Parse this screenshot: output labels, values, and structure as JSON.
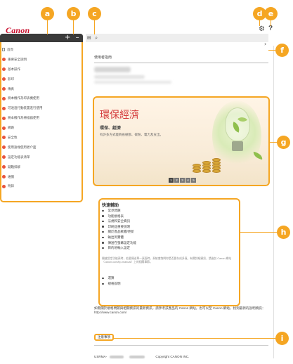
{
  "header": {
    "logo": "Canon",
    "settings_icon": "gear-icon",
    "help_icon": "question-icon"
  },
  "callouts": [
    "a",
    "b",
    "c",
    "d",
    "e",
    "f",
    "g",
    "h",
    "i"
  ],
  "sidebar": {
    "expand_label": "+",
    "collapse_label": "–",
    "items": [
      {
        "label": "首頁",
        "icon": "document-icon"
      },
      {
        "label": "重要安全說明",
        "icon": "dot-icon"
      },
      {
        "label": "基本操作",
        "icon": "dot-icon"
      },
      {
        "label": "影印",
        "icon": "dot-icon"
      },
      {
        "label": "傳真",
        "icon": "dot-icon"
      },
      {
        "label": "將本機作為印表機使用",
        "icon": "dot-icon"
      },
      {
        "label": "可透過行動裝置進行使用",
        "icon": "dot-icon"
      },
      {
        "label": "將本機作為掃描器使用",
        "icon": "dot-icon"
      },
      {
        "label": "網路",
        "icon": "dot-icon"
      },
      {
        "label": "安全性",
        "icon": "dot-icon"
      },
      {
        "label": "使用遠端使用者介面",
        "icon": "dot-icon"
      },
      {
        "label": "設定功能表清單",
        "icon": "dot-icon"
      },
      {
        "label": "疑難排解",
        "icon": "dot-icon"
      },
      {
        "label": "維護",
        "icon": "dot-icon"
      },
      {
        "label": "附錄",
        "icon": "dot-icon"
      }
    ]
  },
  "main": {
    "toolbar_icons": [
      "zoom-in-icon",
      "search-icon"
    ],
    "doc_title": "使用者指南",
    "banner": {
      "title": "環保經濟",
      "subtitle": "環保、經濟",
      "description": "有許多方式能夠省紙張、碳粉、電力及支出。",
      "pages": [
        "1",
        "2",
        "3",
        "4",
        "5"
      ],
      "active_page": 0
    },
    "quick_help": {
      "title": "快速輔助",
      "items": [
        "常見問題",
        "功能規格表",
        "法規和安全資訊",
        "印刷品重要說明",
        "關於產品軟體/更新",
        "輸出到實體",
        "傳送在螢幕設定功能",
        "目的地輸入設定"
      ],
      "note": "開啟設定功能表時，若要傳送單一頁面時，系統會詢問你是否要存成多頁。有關詳細資訊，請造訪 Canon 網站（canon.com/bp-manual）上的相關章節。",
      "extra_items": [
        "運算",
        "規格說明"
      ]
    },
    "footer_text": "如需關於規格問題與相關資訊的最新資訊，請參考該產品的 Canon 網站。也可以至 Canon 網站，找到最新的說明資訊：http://www.canon.com/",
    "notice_button": "注意事項",
    "copyright": "Copyright CANON INC."
  },
  "colors": {
    "accent": "#f5a623",
    "brand": "#c8102e",
    "banner_title": "#d4393a",
    "sidebar_toolbar": "#3a3a3a"
  }
}
